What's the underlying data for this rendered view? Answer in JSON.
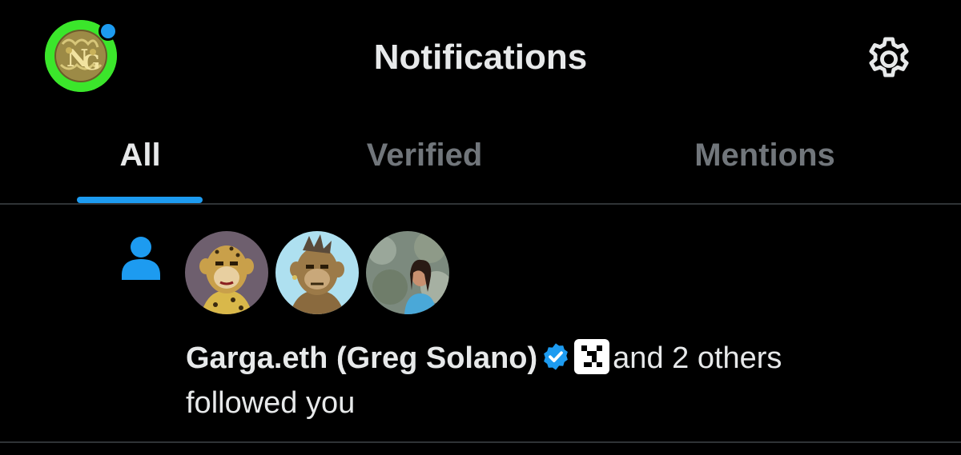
{
  "header": {
    "title": "Notifications",
    "avatar_icon": "profile-avatar-monogram",
    "unread_dot_color": "#1d9bf0",
    "settings_icon": "gear-icon"
  },
  "tabs": [
    {
      "label": "All",
      "active": true
    },
    {
      "label": "Verified",
      "active": false
    },
    {
      "label": "Mentions",
      "active": false
    }
  ],
  "colors": {
    "background": "#000000",
    "accent": "#1d9bf0",
    "text_primary": "#e7e9ea",
    "text_secondary": "#71767b",
    "divider": "#2f3336"
  },
  "notification": {
    "type_icon": "person-icon",
    "follower_avatars": [
      "ape-avatar-leopard",
      "ape-avatar-blue",
      "photo-avatar"
    ],
    "user_name": "Garga.eth (Greg Solano)",
    "verified_badge": "verified-badge-icon",
    "affiliate_badge": "affiliate-badge-icon",
    "others_text": "and 2 others",
    "action_text": "followed you"
  }
}
